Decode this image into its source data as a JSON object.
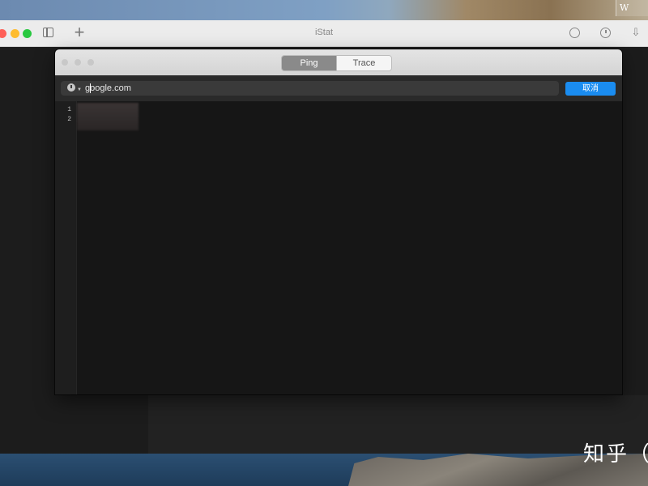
{
  "browser": {
    "title": "iStat",
    "icons": [
      "sidebar-icon",
      "plus-icon",
      "shield-icon",
      "clock-icon",
      "share-icon"
    ]
  },
  "window": {
    "tabs": [
      {
        "label": "Ping",
        "active": true
      },
      {
        "label": "Trace",
        "active": false
      }
    ],
    "address": {
      "value": "google.com",
      "icon": "history-clock-icon"
    },
    "cancel_label": "取消",
    "line_numbers": [
      "1",
      "2"
    ]
  },
  "watermark": {
    "brand": "知乎",
    "paren": "（",
    "corner_text": "W"
  },
  "colors": {
    "accent": "#1a8cf0",
    "window_bg": "#161616",
    "titlebar": "#dcdcdc"
  }
}
